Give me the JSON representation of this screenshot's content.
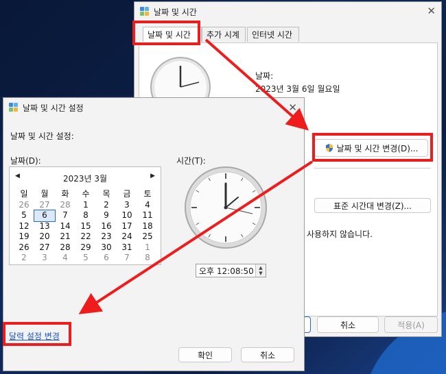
{
  "back_window": {
    "title": "날짜 및 시간",
    "tabs": [
      "날짜 및 시간",
      "추가 시계",
      "인터넷 시간"
    ],
    "date_label": "날짜:",
    "date_value": "2023년 3월 6일 월요일",
    "change_button": "날짜 및 시간 변경(D)...",
    "timezone_button": "표준 시간대 변경(Z)...",
    "dst_text": "사용하지 않습니다.",
    "cancel_button": "취소",
    "apply_button": "적용(A)"
  },
  "front_window": {
    "title": "날짜 및 시간 설정",
    "subtitle": "날짜 및 시간 설정:",
    "date_label": "날짜(D):",
    "time_label": "시간(T):",
    "calendar": {
      "month_label": "2023년 3월",
      "weekdays": [
        "일",
        "월",
        "화",
        "수",
        "목",
        "금",
        "토"
      ],
      "rows": [
        [
          "26",
          "27",
          "28",
          "1",
          "2",
          "3",
          "4"
        ],
        [
          "5",
          "6",
          "7",
          "8",
          "9",
          "10",
          "11"
        ],
        [
          "12",
          "13",
          "14",
          "15",
          "16",
          "17",
          "18"
        ],
        [
          "19",
          "20",
          "21",
          "22",
          "23",
          "24",
          "25"
        ],
        [
          "26",
          "27",
          "28",
          "29",
          "30",
          "31",
          "1"
        ],
        [
          "2",
          "3",
          "4",
          "5",
          "6",
          "7",
          "8"
        ]
      ],
      "selected": "6"
    },
    "time_value": "오후 12:08:50",
    "calendar_link": "달력 설정 변경",
    "ok_button": "확인",
    "cancel_button": "취소"
  },
  "colors": {
    "highlight": "#ee1c1c",
    "link": "#1a55c9"
  }
}
